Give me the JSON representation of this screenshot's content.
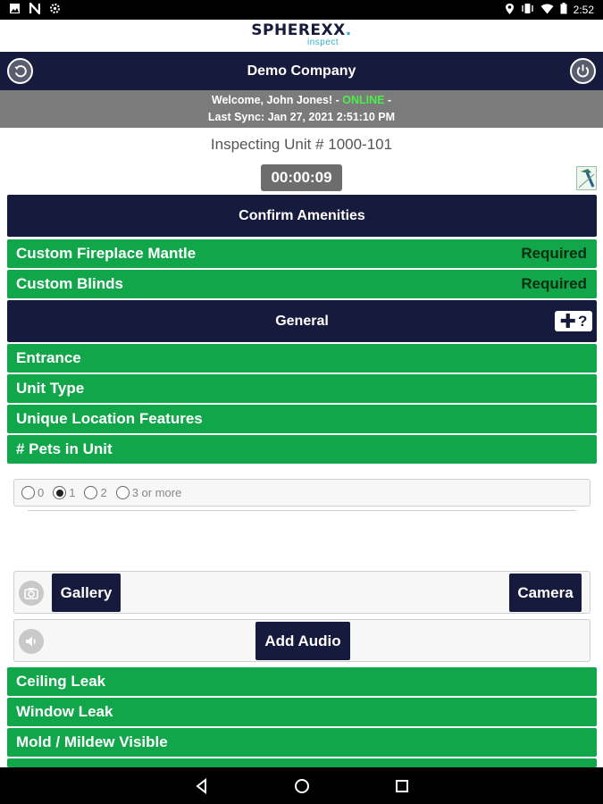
{
  "status_bar": {
    "time": "2:52",
    "left_icons": [
      "image-icon",
      "n-icon",
      "settings-cog-icon"
    ],
    "right_icons": [
      "location-icon",
      "vibrate-icon",
      "wifi-icon",
      "battery-icon"
    ]
  },
  "logo": {
    "main": "SPHEREXX",
    "dot": ".",
    "sub": "inspect"
  },
  "header": {
    "title": "Demo Company",
    "back_icon": "back-arrow-icon",
    "power_icon": "power-icon"
  },
  "welcome": {
    "greeting": "Welcome, John Jones! - ",
    "status": "ONLINE",
    "dash": " -",
    "last_sync": "Last Sync: Jan 27, 2021 2:51:10 PM"
  },
  "inspection": {
    "unit": "Inspecting Unit # 1000-101",
    "timer": "00:00:09"
  },
  "sections": {
    "amenities": {
      "title": "Confirm Amenities",
      "items": [
        {
          "label": "Custom Fireplace Mantle",
          "status": "Required"
        },
        {
          "label": "Custom Blinds",
          "status": "Required"
        }
      ]
    },
    "general": {
      "title": "General",
      "add_help_icon": "plus-question-icon",
      "items": [
        {
          "label": "Entrance"
        },
        {
          "label": "Unit Type"
        },
        {
          "label": "Unique Location Features"
        },
        {
          "label": "# Pets in Unit"
        }
      ]
    }
  },
  "pets_question": {
    "options": [
      "0",
      "1",
      "2",
      "3 or more"
    ],
    "selected": "1",
    "gallery_label": "Gallery",
    "camera_label": "Camera",
    "audio_label": "Add Audio"
  },
  "more_items": [
    {
      "label": "Ceiling Leak"
    },
    {
      "label": "Window Leak"
    },
    {
      "label": "Mold / Mildew Visible"
    }
  ],
  "colors": {
    "navy": "#161a3c",
    "green": "#12a64a",
    "online": "#4aee4a",
    "gray_bar": "#7b7b7b"
  }
}
